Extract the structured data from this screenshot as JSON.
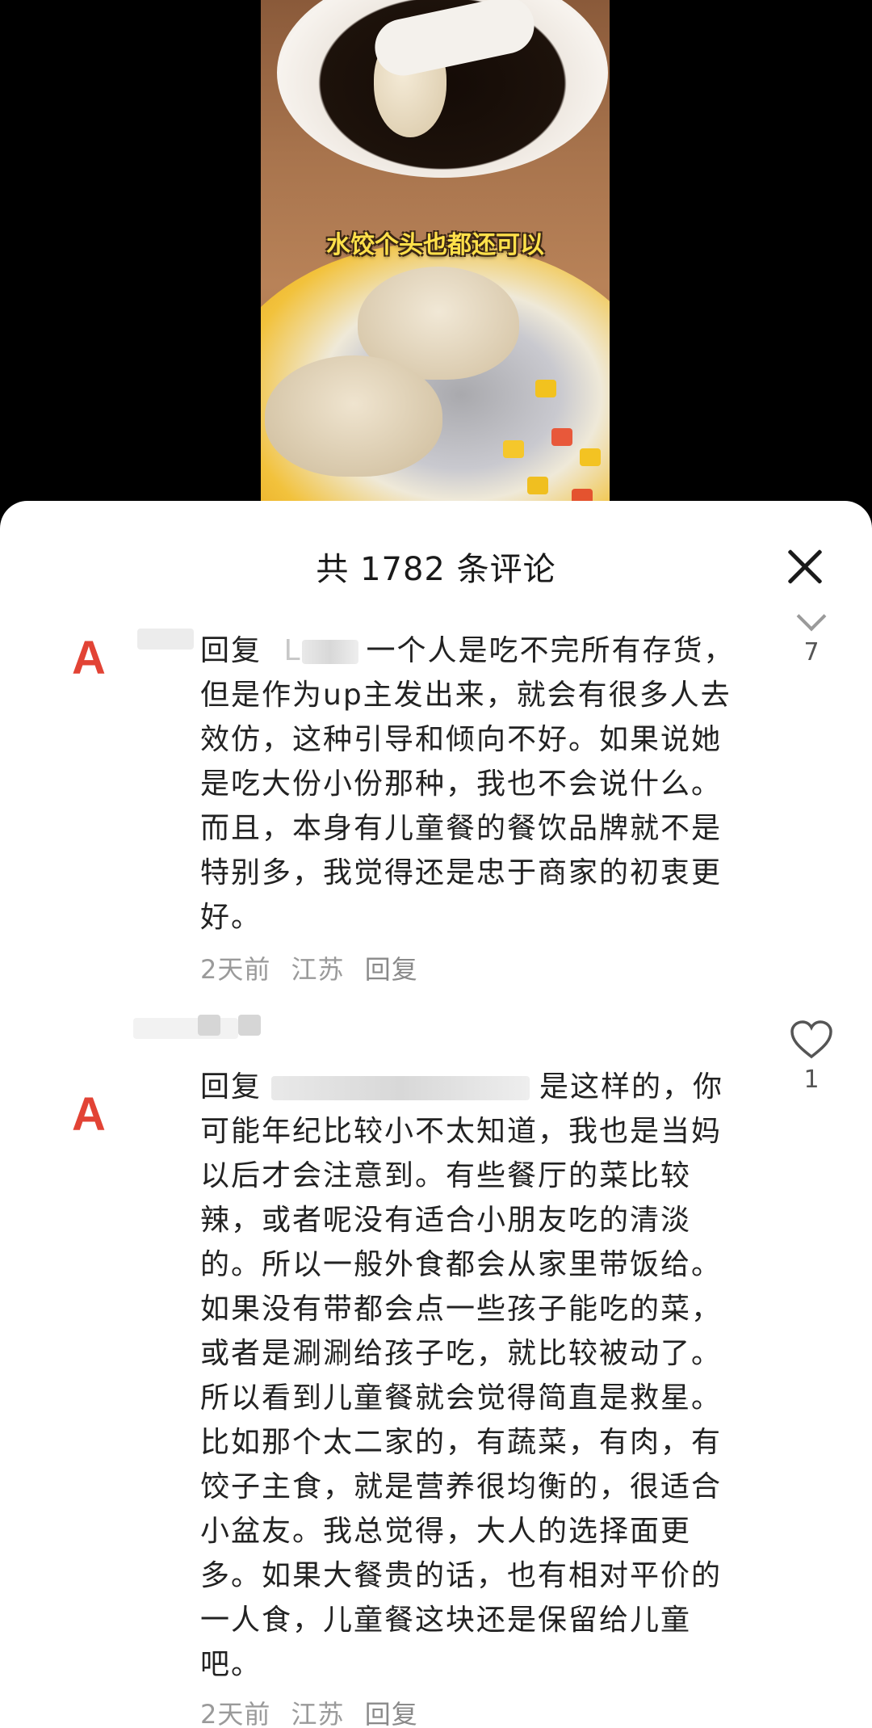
{
  "video": {
    "caption": "水饺个头也都还可以"
  },
  "comments_sheet": {
    "title": "共 1782 条评论",
    "close_icon": "close-icon",
    "comments": [
      {
        "avatar_letter": "A",
        "reply_prefix": "回复",
        "reply_to_visible": "L",
        "text": "一个人是吃不完所有存货，但是作为up主发出来，就会有很多人去效仿，这种引导和倾向不好。如果说她是吃大份小份那种，我也不会说什么。而且，本身有儿童餐的餐饮品牌就不是特别多，我觉得还是忠于商家的初衷更好。",
        "time": "2天前",
        "location": "江苏",
        "reply_label": "回复",
        "like_count": "7",
        "like_icon": "chevron-down-icon"
      },
      {
        "avatar_letter": "A",
        "reply_prefix": "回复",
        "text": "是这样的，你可能年纪比较小不太知道，我也是当妈以后才会注意到。有些餐厅的菜比较辣，或者呢没有适合小朋友吃的清淡的。所以一般外食都会从家里带饭给。如果没有带都会点一些孩子能吃的菜，或者是涮涮给孩子吃，就比较被动了。所以看到儿童餐就会觉得简直是救星。比如那个太二家的，有蔬菜，有肉，有饺子主食，就是营养很均衡的，很适合小盆友。我总觉得，大人的选择面更多。如果大餐贵的话，也有相对平价的一人食，儿童餐这块还是保留给儿童吧。",
        "time": "2天前",
        "location": "江苏",
        "reply_label": "回复",
        "like_count": "1",
        "like_icon": "heart-icon"
      }
    ]
  }
}
